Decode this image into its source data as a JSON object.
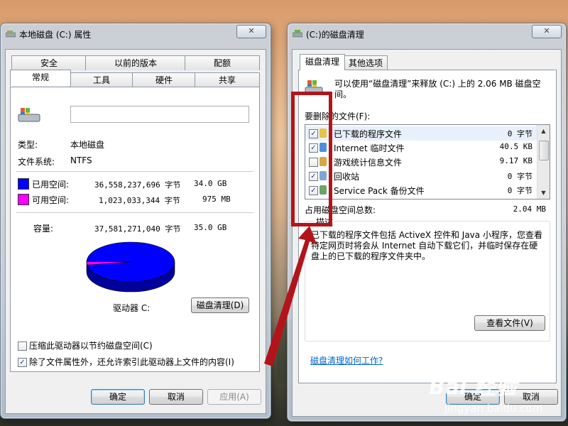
{
  "props_window": {
    "title": "本地磁盘 (C:) 属性",
    "close_label": "✕",
    "tabs_row1": [
      "安全",
      "以前的版本",
      "配额"
    ],
    "tabs_row2": [
      "常规",
      "工具",
      "硬件",
      "共享"
    ],
    "active_tab": "常规",
    "name_value": "",
    "type_label": "类型:",
    "type_value": "本地磁盘",
    "fs_label": "文件系统:",
    "fs_value": "NTFS",
    "used": {
      "label": "已用空间:",
      "bytes": "36,558,237,696 字节",
      "size": "34.0 GB",
      "color": "#0000ff"
    },
    "free": {
      "label": "可用空间:",
      "bytes": "1,023,033,344 字节",
      "size": "975 MB",
      "color": "#ff00ff"
    },
    "capacity": {
      "label": "容量:",
      "bytes": "37,581,271,040 字节",
      "size": "35.0 GB"
    },
    "drive_label": "驱动器 C:",
    "cleanup_button": "磁盘清理(D)",
    "compress_label": "压缩此驱动器以节约磁盘空间(C)",
    "compress_checked": false,
    "index_label": "除了文件属性外，还允许索引此驱动器上文件的内容(I)",
    "index_checked": true,
    "ok_button": "确定",
    "cancel_button": "取消",
    "apply_button": "应用(A)"
  },
  "cleanup_window": {
    "title": "(C:)的磁盘清理",
    "close_label": "✕",
    "tabs": [
      "磁盘清理",
      "其他选项"
    ],
    "intro": "可以使用“磁盘清理”来释放  (C:) 上的 2.06 MB 磁盘空间。",
    "files_label": "要删除的文件(F):",
    "files": [
      {
        "name": "已下载的程序文件",
        "size": "0 字节",
        "checked": true,
        "icon_color": "#e8c34a"
      },
      {
        "name": "Internet 临时文件",
        "size": "40.5 KB",
        "checked": true,
        "icon_color": "#4f8fd8"
      },
      {
        "name": "游戏统计信息文件",
        "size": "9.17 KB",
        "checked": false,
        "icon_color": "#d9a640"
      },
      {
        "name": "回收站",
        "size": "0 字节",
        "checked": true,
        "icon_color": "#7aa7d6"
      },
      {
        "name": "Service Pack 备份文件",
        "size": "0 字节",
        "checked": true,
        "icon_color": "#6aa56a"
      }
    ],
    "total_label": "占用磁盘空间总数:",
    "total_value": "2.04 MB",
    "desc_legend": "描述",
    "description": "已下载的程序文件包括 ActiveX 控件和 Java 小程序，您查看特定网页时将会从 Internet 自动下载它们，并临时保存在硬盘上的已下载的程序文件夹中。",
    "view_files_button": "查看文件(V)",
    "help_link": "磁盘清理如何工作?",
    "ok_button": "确定",
    "cancel_button": "取消"
  },
  "used_fraction": 0.973,
  "annotation_color": "#b3141a",
  "watermark": {
    "brand": "Bai 经验",
    "url": "jingyan.baidu.com"
  }
}
